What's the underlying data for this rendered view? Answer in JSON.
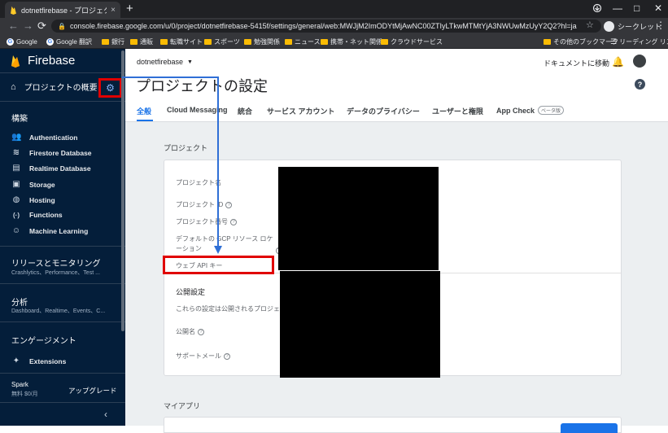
{
  "browser": {
    "tab_title": "dotnetfirebase - プロジェクトの設定",
    "tab_close": "×",
    "new_tab": "+",
    "minimize": "—",
    "maximize": "□",
    "close": "✕",
    "back": "←",
    "forward": "→",
    "reload": "⟳",
    "url": "console.firebase.google.com/u/0/project/dotnetfirebase-5415f/settings/general/web:MWJjM2ImODYtMjAwNC00ZTIyLTkwMTMtYjA3NWUwMzUyY2Q2?hl=ja",
    "incognito_label": "シークレット",
    "menu": "⋮",
    "bookmarks": [
      {
        "label": "Google",
        "icon": "google-icon"
      },
      {
        "label": "Google 翻訳",
        "icon": "google-icon"
      },
      {
        "label": "銀行",
        "icon": "folder-icon"
      },
      {
        "label": "通販",
        "icon": "folder-icon"
      },
      {
        "label": "転職サイト",
        "icon": "folder-icon"
      },
      {
        "label": "スポーツ",
        "icon": "folder-icon"
      },
      {
        "label": "勉強関係",
        "icon": "folder-icon"
      },
      {
        "label": "ニュース",
        "icon": "folder-icon"
      },
      {
        "label": "携帯・ネット関係",
        "icon": "folder-icon"
      },
      {
        "label": "クラウドサービス",
        "icon": "folder-icon"
      }
    ],
    "other_bookmarks": "その他のブックマーク",
    "reading_list": "リーディング リスト"
  },
  "sidebar": {
    "brand": "Firebase",
    "overview": "プロジェクトの概要",
    "build_title": "構築",
    "build_items": [
      {
        "label": "Authentication",
        "icon": "people-icon",
        "glyph": "👥"
      },
      {
        "label": "Firestore Database",
        "icon": "firestore-icon",
        "glyph": "≋"
      },
      {
        "label": "Realtime Database",
        "icon": "database-icon",
        "glyph": "▤"
      },
      {
        "label": "Storage",
        "icon": "storage-icon",
        "glyph": "▣"
      },
      {
        "label": "Hosting",
        "icon": "globe-icon",
        "glyph": "◍"
      },
      {
        "label": "Functions",
        "icon": "functions-icon",
        "glyph": "(·)"
      },
      {
        "label": "Machine Learning",
        "icon": "robot-icon",
        "glyph": "☺"
      }
    ],
    "release_title": "リリースとモニタリング",
    "release_sub": "Crashlytics、Performance、Test ...",
    "analytics_title": "分析",
    "analytics_sub": "Dashboard、Realtime、Events、C...",
    "engage_title": "エンゲージメント",
    "extensions": "Extensions",
    "plan_name": "Spark",
    "plan_price": "無料 $0/月",
    "upgrade": "アップグレード"
  },
  "header": {
    "project": "dotnetfirebase",
    "docs_link": "ドキュメントに移動",
    "title": "プロジェクトの設定",
    "tabs": [
      {
        "label": "全般"
      },
      {
        "label": "Cloud Messaging"
      },
      {
        "label": "統合"
      },
      {
        "label": "サービス アカウント"
      },
      {
        "label": "データのプライバシー"
      },
      {
        "label": "ユーザーと権限"
      },
      {
        "label": "App Check"
      }
    ],
    "beta_badge": "ベータ版"
  },
  "project_card": {
    "section": "プロジェクト",
    "fields": {
      "name": "プロジェクト名",
      "id": "プロジェクト ID",
      "number": "プロジェクト番号",
      "location": "デフォルトの GCP リソース ロケーション",
      "api_key": "ウェブ API キー"
    },
    "public_title": "公開設定",
    "public_desc": "これらの設定は公開されるプロジェクト",
    "public_name": "公開名",
    "support_email": "サポートメール"
  },
  "my_apps": "マイアプリ",
  "colors": {
    "sidebar_bg": "#041e3a",
    "accent": "#1a73e8",
    "annotation_red": "#e00000",
    "firebase_yellow": "#ffca28"
  }
}
